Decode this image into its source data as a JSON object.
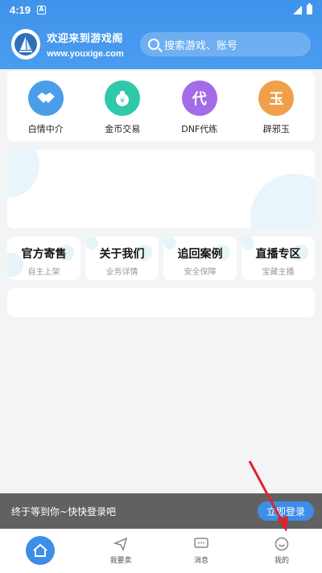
{
  "status_bar": {
    "time": "4:19",
    "notification_badge": "A"
  },
  "header": {
    "title": "欢迎来到游戏阁",
    "url": "www.youxige.com",
    "search_placeholder": "搜索游戏、账号"
  },
  "quick_menu": [
    {
      "label": "白情中介",
      "icon": "handshake-icon",
      "color": "#4a9de8"
    },
    {
      "label": "金币交易",
      "icon": "money-bag-icon",
      "color": "#2fc8a8"
    },
    {
      "label": "DNF代练",
      "icon": "dai-char-icon",
      "glyph": "代",
      "color": "#a46be8"
    },
    {
      "label": "辟邪玉",
      "icon": "jade-char-icon",
      "glyph": "玉",
      "color": "#f0a04a"
    }
  ],
  "services": [
    {
      "title": "官方寄售",
      "subtitle": "自主上架"
    },
    {
      "title": "关于我们",
      "subtitle": "业务详情"
    },
    {
      "title": "追回案例",
      "subtitle": "安全保障"
    },
    {
      "title": "直播专区",
      "subtitle": "宝藏主播"
    }
  ],
  "login_bar": {
    "text": "终于等到你~快快登录吧",
    "button": "立即登录"
  },
  "bottom_nav": [
    {
      "label": "",
      "icon": "home-icon"
    },
    {
      "label": "我要卖",
      "icon": "send-icon"
    },
    {
      "label": "消息",
      "icon": "message-icon"
    },
    {
      "label": "我的",
      "icon": "smile-icon"
    }
  ],
  "colors": {
    "primary": "#3d8ee6",
    "annotation_arrow": "#d9262e"
  }
}
